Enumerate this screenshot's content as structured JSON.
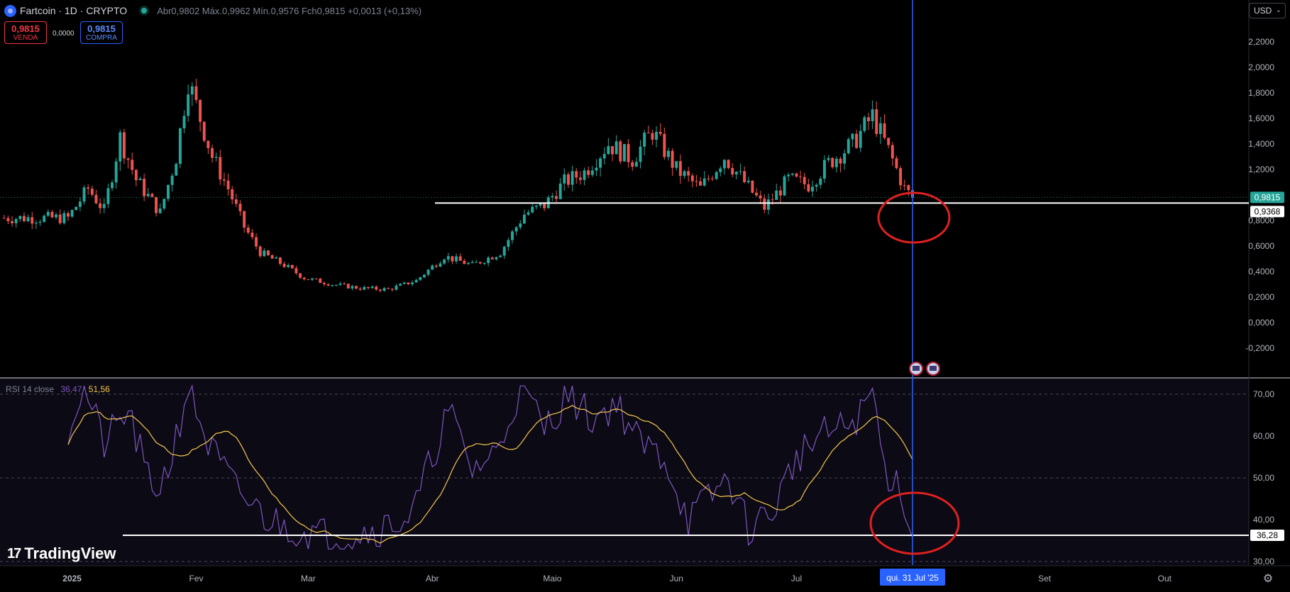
{
  "header": {
    "title": "Fartcoin · 1D · CRYPTO",
    "ohlc": "Abr0,9802 Máx.0,9962 Mín.0,9576 Fch0,9815 +0,0013 (+0,13%)"
  },
  "trade": {
    "sell_price": "0,9815",
    "sell_label": "VENDA",
    "spread": "0,0000",
    "buy_price": "0,9815",
    "buy_label": "COMPRA"
  },
  "currency": "USD",
  "rsi_legend": {
    "label": "RSI 14 close",
    "value1": "36,47",
    "value2": "51,56"
  },
  "brand": "TradingView",
  "crosshair_date": "qui. 31 Jul '25",
  "colors": {
    "up": "#26a69a",
    "down": "#ef5350",
    "rsi": "#7e57c2",
    "rsi_ma": "#f5c84c",
    "crosshair": "#2962ff",
    "annotation": "#e02020",
    "background": "#000000"
  },
  "icons": [
    "symbol-logo-icon",
    "market-open-icon",
    "flag-icon",
    "settings-icon",
    "chevron-down-icon"
  ],
  "chart_data": [
    {
      "type": "candlestick",
      "title": "Fartcoin · 1D · CRYPTO",
      "ylim": [
        -0.2,
        2.35
      ],
      "y_ticks": [
        "2,2000",
        "2,0000",
        "1,8000",
        "1,6000",
        "1,4000",
        "1,2000",
        "0,8000",
        "0,6000",
        "0,4000",
        "0,2000",
        "0,0000",
        "-0,2000"
      ],
      "x_ticks": [
        "2025",
        "Fev",
        "Mar",
        "Abr",
        "Maio",
        "Jun",
        "Jul",
        "Set",
        "Out"
      ],
      "last_price": "0,9815",
      "horizontal_line": "0,9368",
      "grid": false,
      "close_series_approx": [
        {
          "date": "2025-01-01",
          "close": 0.82
        },
        {
          "date": "2025-01-06",
          "close": 1.05
        },
        {
          "date": "2025-01-10",
          "close": 0.88
        },
        {
          "date": "2025-01-14",
          "close": 1.45
        },
        {
          "date": "2025-01-18",
          "close": 1.12
        },
        {
          "date": "2025-01-24",
          "close": 0.86
        },
        {
          "date": "2025-01-28",
          "close": 1.3
        },
        {
          "date": "2025-01-31",
          "close": 1.9
        },
        {
          "date": "2025-02-02",
          "close": 1.7
        },
        {
          "date": "2025-02-06",
          "close": 1.3
        },
        {
          "date": "2025-02-10",
          "close": 1.05
        },
        {
          "date": "2025-02-14",
          "close": 0.75
        },
        {
          "date": "2025-02-18",
          "close": 0.55
        },
        {
          "date": "2025-02-24",
          "close": 0.45
        },
        {
          "date": "2025-03-01",
          "close": 0.35
        },
        {
          "date": "2025-03-08",
          "close": 0.3
        },
        {
          "date": "2025-03-15",
          "close": 0.27
        },
        {
          "date": "2025-03-22",
          "close": 0.26
        },
        {
          "date": "2025-03-29",
          "close": 0.33
        },
        {
          "date": "2025-04-05",
          "close": 0.52
        },
        {
          "date": "2025-04-12",
          "close": 0.45
        },
        {
          "date": "2025-04-19",
          "close": 0.55
        },
        {
          "date": "2025-04-25",
          "close": 0.85
        },
        {
          "date": "2025-04-30",
          "close": 0.92
        },
        {
          "date": "2025-05-05",
          "close": 1.1
        },
        {
          "date": "2025-05-10",
          "close": 1.18
        },
        {
          "date": "2025-05-16",
          "close": 1.4
        },
        {
          "date": "2025-05-22",
          "close": 1.28
        },
        {
          "date": "2025-05-27",
          "close": 1.5
        },
        {
          "date": "2025-06-02",
          "close": 1.2
        },
        {
          "date": "2025-06-08",
          "close": 1.05
        },
        {
          "date": "2025-06-14",
          "close": 1.3
        },
        {
          "date": "2025-06-19",
          "close": 1.1
        },
        {
          "date": "2025-06-24",
          "close": 0.9
        },
        {
          "date": "2025-06-30",
          "close": 1.12
        },
        {
          "date": "2025-07-05",
          "close": 1.08
        },
        {
          "date": "2025-07-10",
          "close": 1.25
        },
        {
          "date": "2025-07-16",
          "close": 1.4
        },
        {
          "date": "2025-07-21",
          "close": 1.62
        },
        {
          "date": "2025-07-25",
          "close": 1.35
        },
        {
          "date": "2025-07-29",
          "close": 1.05
        },
        {
          "date": "2025-07-31",
          "close": 0.98
        }
      ]
    },
    {
      "type": "line",
      "title": "RSI 14 close",
      "ylim": [
        28,
        72
      ],
      "y_ticks": [
        "70,00",
        "60,00",
        "50,00",
        "40,00",
        "30,00"
      ],
      "guide_lines": [
        70,
        50,
        30
      ],
      "horizontal_line": "36,28",
      "series": [
        {
          "name": "RSI 14 close",
          "value_last": 36.47
        },
        {
          "name": "RSI-based MA",
          "value_last": 51.56
        }
      ],
      "rsi_series_approx": [
        {
          "date": "2025-01-01",
          "rsi": 62
        },
        {
          "date": "2025-01-05",
          "rsi": 72
        },
        {
          "date": "2025-01-10",
          "rsi": 58
        },
        {
          "date": "2025-01-16",
          "rsi": 66
        },
        {
          "date": "2025-01-22",
          "rsi": 46
        },
        {
          "date": "2025-01-26",
          "rsi": 52
        },
        {
          "date": "2025-01-31",
          "rsi": 72
        },
        {
          "date": "2025-02-05",
          "rsi": 58
        },
        {
          "date": "2025-02-12",
          "rsi": 47
        },
        {
          "date": "2025-02-20",
          "rsi": 40
        },
        {
          "date": "2025-03-01",
          "rsi": 37
        },
        {
          "date": "2025-03-10",
          "rsi": 36
        },
        {
          "date": "2025-03-20",
          "rsi": 38
        },
        {
          "date": "2025-03-28",
          "rsi": 41
        },
        {
          "date": "2025-04-02",
          "rsi": 55
        },
        {
          "date": "2025-04-06",
          "rsi": 66
        },
        {
          "date": "2025-04-12",
          "rsi": 52
        },
        {
          "date": "2025-04-18",
          "rsi": 56
        },
        {
          "date": "2025-04-24",
          "rsi": 72
        },
        {
          "date": "2025-04-30",
          "rsi": 62
        },
        {
          "date": "2025-05-06",
          "rsi": 70
        },
        {
          "date": "2025-05-12",
          "rsi": 64
        },
        {
          "date": "2025-05-18",
          "rsi": 68
        },
        {
          "date": "2025-05-24",
          "rsi": 58
        },
        {
          "date": "2025-05-30",
          "rsi": 55
        },
        {
          "date": "2025-06-05",
          "rsi": 40
        },
        {
          "date": "2025-06-10",
          "rsi": 45
        },
        {
          "date": "2025-06-15",
          "rsi": 50
        },
        {
          "date": "2025-06-20",
          "rsi": 38
        },
        {
          "date": "2025-06-26",
          "rsi": 42
        },
        {
          "date": "2025-07-02",
          "rsi": 55
        },
        {
          "date": "2025-07-08",
          "rsi": 60
        },
        {
          "date": "2025-07-14",
          "rsi": 62
        },
        {
          "date": "2025-07-18",
          "rsi": 65
        },
        {
          "date": "2025-07-21",
          "rsi": 71
        },
        {
          "date": "2025-07-24",
          "rsi": 52
        },
        {
          "date": "2025-07-28",
          "rsi": 48
        },
        {
          "date": "2025-07-31",
          "rsi": 36.5
        }
      ]
    }
  ]
}
